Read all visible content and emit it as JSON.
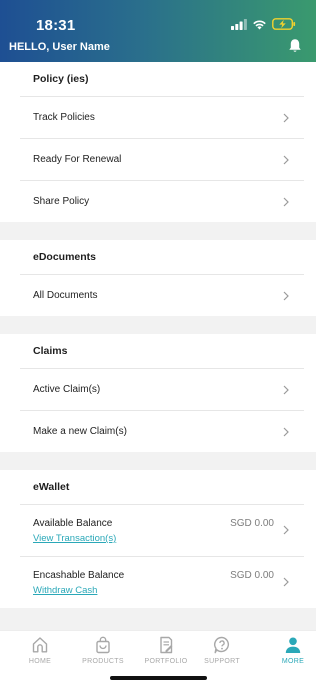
{
  "status_bar": {
    "time": "18:31"
  },
  "header": {
    "greeting": "HELLO, User Name"
  },
  "sections": {
    "policy": {
      "title": "Policy (ies)",
      "items": [
        "Track Policies",
        "Ready For Renewal",
        "Share Policy"
      ]
    },
    "edocuments": {
      "title": "eDocuments",
      "items": [
        "All Documents"
      ]
    },
    "claims": {
      "title": "Claims",
      "items": [
        "Active Claim(s)",
        "Make a new Claim(s)"
      ]
    },
    "ewallet": {
      "title": "eWallet",
      "available": {
        "label": "Available Balance",
        "amount": "SGD 0.00",
        "link": "View Transaction(s)"
      },
      "encashable": {
        "label": "Encashable Balance",
        "amount": "SGD 0.00",
        "link": "Withdraw Cash"
      }
    }
  },
  "bottom_nav": {
    "items": [
      "HOME",
      "PRODUCTS",
      "PORTFOLIO",
      "SUPPORT",
      "MORE"
    ],
    "active": "MORE"
  },
  "colors": {
    "accent": "#2aa8b8",
    "header_start": "#1e4f93",
    "header_end": "#3a9a6e",
    "battery_charging": "#f2d22e"
  },
  "icons": {
    "status": [
      "signal-icon",
      "wifi-icon",
      "battery-charging-icon"
    ],
    "header": "bell-icon",
    "row": "chevron-right-icon",
    "nav": [
      "home-icon",
      "shopping-bag-icon",
      "portfolio-document-icon",
      "support-question-icon",
      "user-profile-icon"
    ]
  }
}
